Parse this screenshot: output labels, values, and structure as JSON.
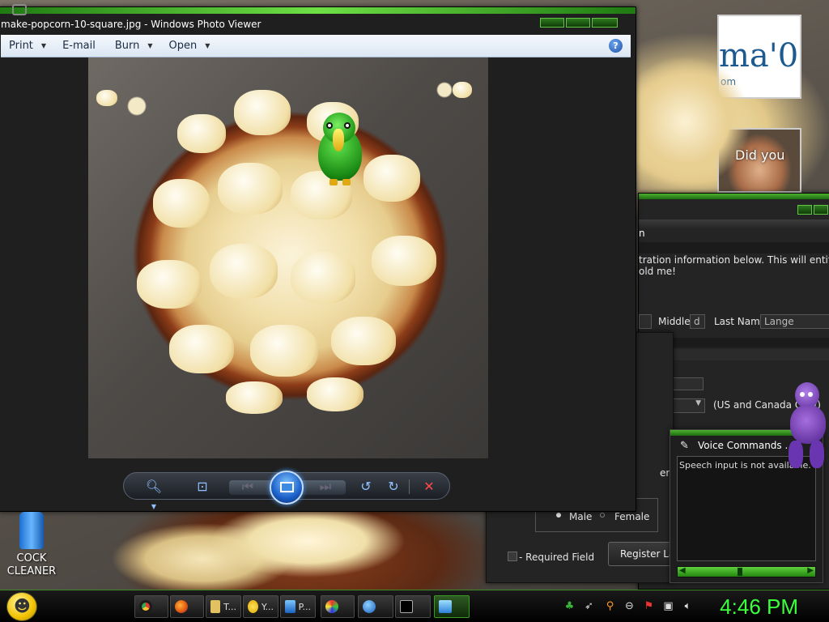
{
  "photo_viewer": {
    "title": "make-popcorn-10-square.jpg - Windows Photo Viewer",
    "menu": [
      {
        "label": "Print",
        "has_dropdown": true
      },
      {
        "label": "E-mail",
        "has_dropdown": false
      },
      {
        "label": "Burn",
        "has_dropdown": true
      },
      {
        "label": "Open",
        "has_dropdown": true
      }
    ],
    "help": "?"
  },
  "thumbs": {
    "thumb1_text": "ma'0",
    "thumb1_sub": "om",
    "thumb2_text": "Did you"
  },
  "form": {
    "title_fragment": "n",
    "intro_line1": "tration information below. This will entitle you to FF",
    "intro_line2": "old me!",
    "middle_label": "Middle:",
    "middle_value": "d",
    "last_name_label": "Last Name:",
    "last_name_value": "Lange",
    "country_note": "(US and Canada Only)",
    "email_fragment": "ema@ya",
    "gender_male": "Male",
    "gender_female": "Female",
    "required_note": "- Required Field",
    "register_later": "Register Later"
  },
  "voice": {
    "title": "Voice Commands ...",
    "body": "Speech input is not available."
  },
  "desktop_icon": {
    "label_line1": "COCK",
    "label_line2": "CLEANER"
  },
  "taskbar": {
    "buttons": [
      {
        "label": "T...",
        "icon": "folder-icon"
      },
      {
        "label": "Y...",
        "icon": "yahoo-icon"
      },
      {
        "label": "P...",
        "icon": "monitor-icon"
      }
    ],
    "clock": "4:46 PM"
  }
}
